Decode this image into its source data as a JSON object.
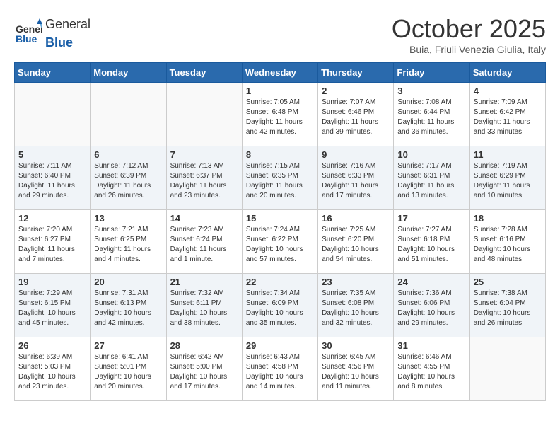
{
  "header": {
    "logo_general": "General",
    "logo_blue": "Blue",
    "month_title": "October 2025",
    "subtitle": "Buia, Friuli Venezia Giulia, Italy"
  },
  "days_of_week": [
    "Sunday",
    "Monday",
    "Tuesday",
    "Wednesday",
    "Thursday",
    "Friday",
    "Saturday"
  ],
  "weeks": [
    {
      "days": [
        {
          "num": "",
          "info": ""
        },
        {
          "num": "",
          "info": ""
        },
        {
          "num": "",
          "info": ""
        },
        {
          "num": "1",
          "info": "Sunrise: 7:05 AM\nSunset: 6:48 PM\nDaylight: 11 hours and 42 minutes."
        },
        {
          "num": "2",
          "info": "Sunrise: 7:07 AM\nSunset: 6:46 PM\nDaylight: 11 hours and 39 minutes."
        },
        {
          "num": "3",
          "info": "Sunrise: 7:08 AM\nSunset: 6:44 PM\nDaylight: 11 hours and 36 minutes."
        },
        {
          "num": "4",
          "info": "Sunrise: 7:09 AM\nSunset: 6:42 PM\nDaylight: 11 hours and 33 minutes."
        }
      ]
    },
    {
      "days": [
        {
          "num": "5",
          "info": "Sunrise: 7:11 AM\nSunset: 6:40 PM\nDaylight: 11 hours and 29 minutes."
        },
        {
          "num": "6",
          "info": "Sunrise: 7:12 AM\nSunset: 6:39 PM\nDaylight: 11 hours and 26 minutes."
        },
        {
          "num": "7",
          "info": "Sunrise: 7:13 AM\nSunset: 6:37 PM\nDaylight: 11 hours and 23 minutes."
        },
        {
          "num": "8",
          "info": "Sunrise: 7:15 AM\nSunset: 6:35 PM\nDaylight: 11 hours and 20 minutes."
        },
        {
          "num": "9",
          "info": "Sunrise: 7:16 AM\nSunset: 6:33 PM\nDaylight: 11 hours and 17 minutes."
        },
        {
          "num": "10",
          "info": "Sunrise: 7:17 AM\nSunset: 6:31 PM\nDaylight: 11 hours and 13 minutes."
        },
        {
          "num": "11",
          "info": "Sunrise: 7:19 AM\nSunset: 6:29 PM\nDaylight: 11 hours and 10 minutes."
        }
      ]
    },
    {
      "days": [
        {
          "num": "12",
          "info": "Sunrise: 7:20 AM\nSunset: 6:27 PM\nDaylight: 11 hours and 7 minutes."
        },
        {
          "num": "13",
          "info": "Sunrise: 7:21 AM\nSunset: 6:25 PM\nDaylight: 11 hours and 4 minutes."
        },
        {
          "num": "14",
          "info": "Sunrise: 7:23 AM\nSunset: 6:24 PM\nDaylight: 11 hours and 1 minute."
        },
        {
          "num": "15",
          "info": "Sunrise: 7:24 AM\nSunset: 6:22 PM\nDaylight: 10 hours and 57 minutes."
        },
        {
          "num": "16",
          "info": "Sunrise: 7:25 AM\nSunset: 6:20 PM\nDaylight: 10 hours and 54 minutes."
        },
        {
          "num": "17",
          "info": "Sunrise: 7:27 AM\nSunset: 6:18 PM\nDaylight: 10 hours and 51 minutes."
        },
        {
          "num": "18",
          "info": "Sunrise: 7:28 AM\nSunset: 6:16 PM\nDaylight: 10 hours and 48 minutes."
        }
      ]
    },
    {
      "days": [
        {
          "num": "19",
          "info": "Sunrise: 7:29 AM\nSunset: 6:15 PM\nDaylight: 10 hours and 45 minutes."
        },
        {
          "num": "20",
          "info": "Sunrise: 7:31 AM\nSunset: 6:13 PM\nDaylight: 10 hours and 42 minutes."
        },
        {
          "num": "21",
          "info": "Sunrise: 7:32 AM\nSunset: 6:11 PM\nDaylight: 10 hours and 38 minutes."
        },
        {
          "num": "22",
          "info": "Sunrise: 7:34 AM\nSunset: 6:09 PM\nDaylight: 10 hours and 35 minutes."
        },
        {
          "num": "23",
          "info": "Sunrise: 7:35 AM\nSunset: 6:08 PM\nDaylight: 10 hours and 32 minutes."
        },
        {
          "num": "24",
          "info": "Sunrise: 7:36 AM\nSunset: 6:06 PM\nDaylight: 10 hours and 29 minutes."
        },
        {
          "num": "25",
          "info": "Sunrise: 7:38 AM\nSunset: 6:04 PM\nDaylight: 10 hours and 26 minutes."
        }
      ]
    },
    {
      "days": [
        {
          "num": "26",
          "info": "Sunrise: 6:39 AM\nSunset: 5:03 PM\nDaylight: 10 hours and 23 minutes."
        },
        {
          "num": "27",
          "info": "Sunrise: 6:41 AM\nSunset: 5:01 PM\nDaylight: 10 hours and 20 minutes."
        },
        {
          "num": "28",
          "info": "Sunrise: 6:42 AM\nSunset: 5:00 PM\nDaylight: 10 hours and 17 minutes."
        },
        {
          "num": "29",
          "info": "Sunrise: 6:43 AM\nSunset: 4:58 PM\nDaylight: 10 hours and 14 minutes."
        },
        {
          "num": "30",
          "info": "Sunrise: 6:45 AM\nSunset: 4:56 PM\nDaylight: 10 hours and 11 minutes."
        },
        {
          "num": "31",
          "info": "Sunrise: 6:46 AM\nSunset: 4:55 PM\nDaylight: 10 hours and 8 minutes."
        },
        {
          "num": "",
          "info": ""
        }
      ]
    }
  ]
}
